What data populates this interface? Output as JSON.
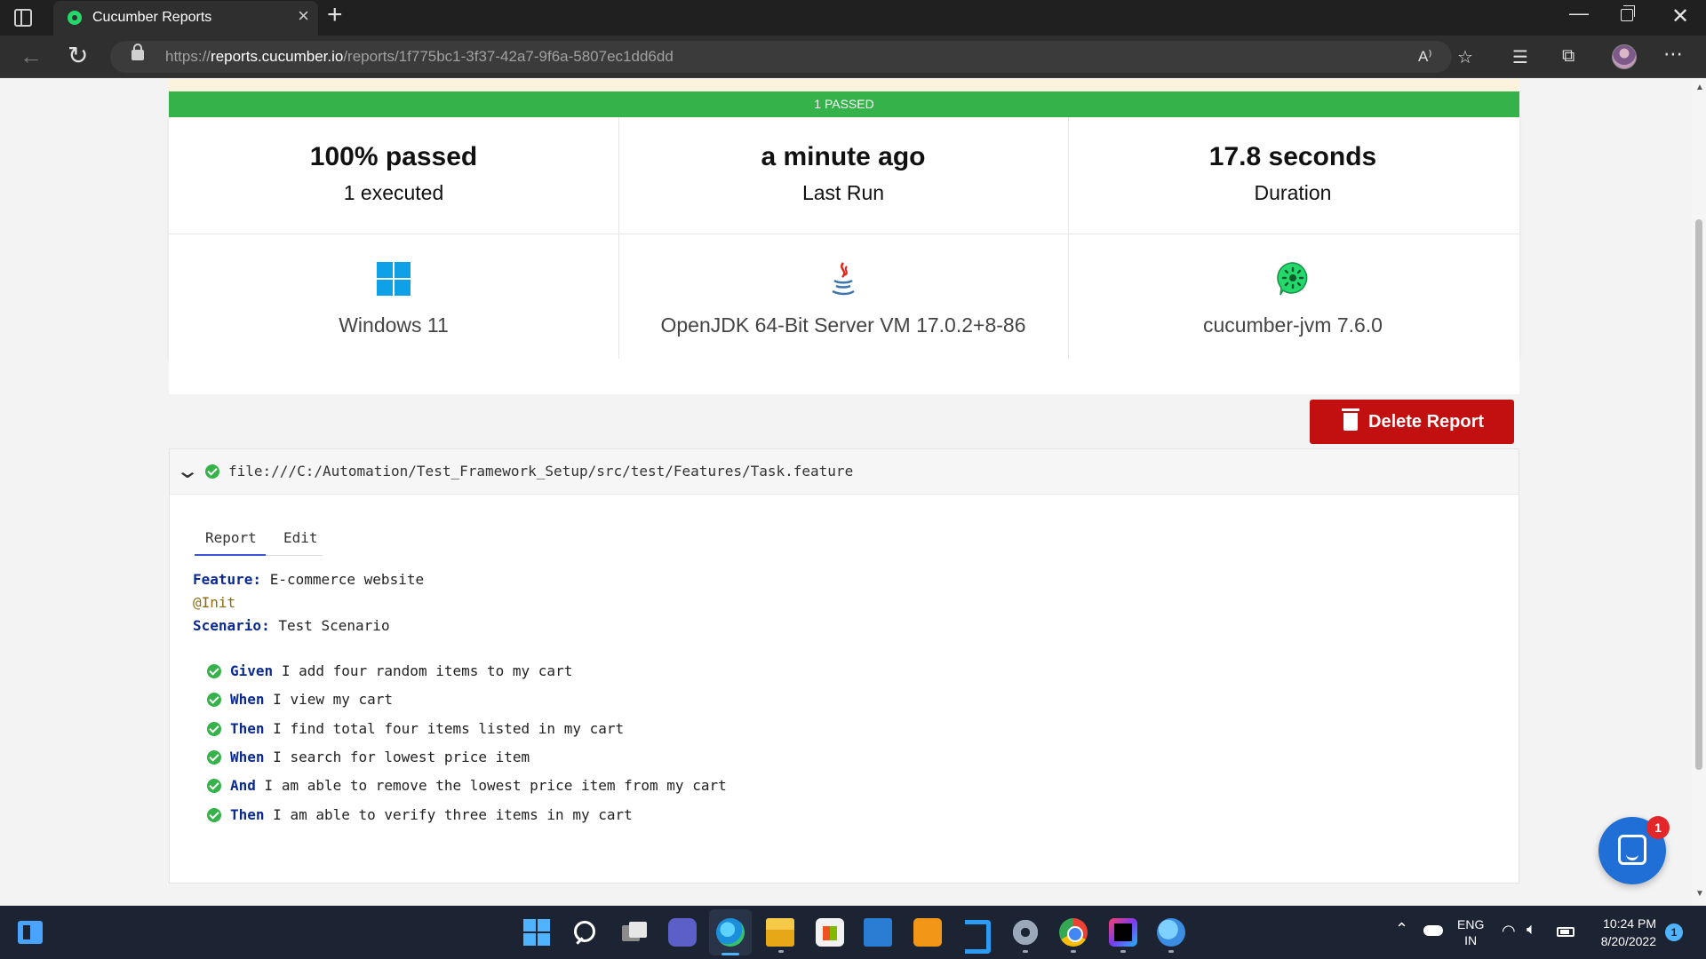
{
  "browser": {
    "tab_title": "Cucumber Reports",
    "url_scheme": "https://",
    "url_host": "reports.cucumber.io",
    "url_path": "/reports/1f775bc1-3f37-42a7-9f6a-5807ec1dd6dd"
  },
  "report": {
    "status_bar": "1 PASSED",
    "stats": {
      "passed_pct": "100% passed",
      "executed": "1 executed",
      "last_run_value": "a minute ago",
      "last_run_label": "Last Run",
      "duration_value": "17.8 seconds",
      "duration_label": "Duration"
    },
    "environment": {
      "os": "Windows 11",
      "runtime": "OpenJDK 64-Bit Server VM 17.0.2+8-86",
      "implementation": "cucumber-jvm 7.6.0"
    },
    "delete_label": "Delete Report",
    "feature_path": "file:///C:/Automation/Test_Framework_Setup/src/test/Features/Task.feature",
    "tabs": {
      "report": "Report",
      "edit": "Edit"
    },
    "feature": {
      "feature_kw": "Feature:",
      "feature_name": "E-commerce website",
      "tag": "@Init",
      "scenario_kw": "Scenario:",
      "scenario_name": "Test Scenario",
      "steps": [
        {
          "kw": "Given",
          "text": "I add four random items to my cart"
        },
        {
          "kw": "When",
          "text": "I view my cart"
        },
        {
          "kw": "Then",
          "text": "I find total four items listed in my cart"
        },
        {
          "kw": "When",
          "text": "I search for lowest price item"
        },
        {
          "kw": "And",
          "text": "I am able to remove the lowest price item from my cart"
        },
        {
          "kw": "Then",
          "text": "I am able to verify three items in my cart"
        }
      ]
    }
  },
  "chat": {
    "badge": "1"
  },
  "taskbar": {
    "lang_top": "ENG",
    "lang_bottom": "IN",
    "time": "10:24 PM",
    "date": "8/20/2022",
    "notifications": "1"
  },
  "colors": {
    "passed_green": "#35b24a",
    "delete_red": "#c20f0f",
    "keyword_blue": "#0b2a8f",
    "tag_olive": "#8c6a10"
  }
}
